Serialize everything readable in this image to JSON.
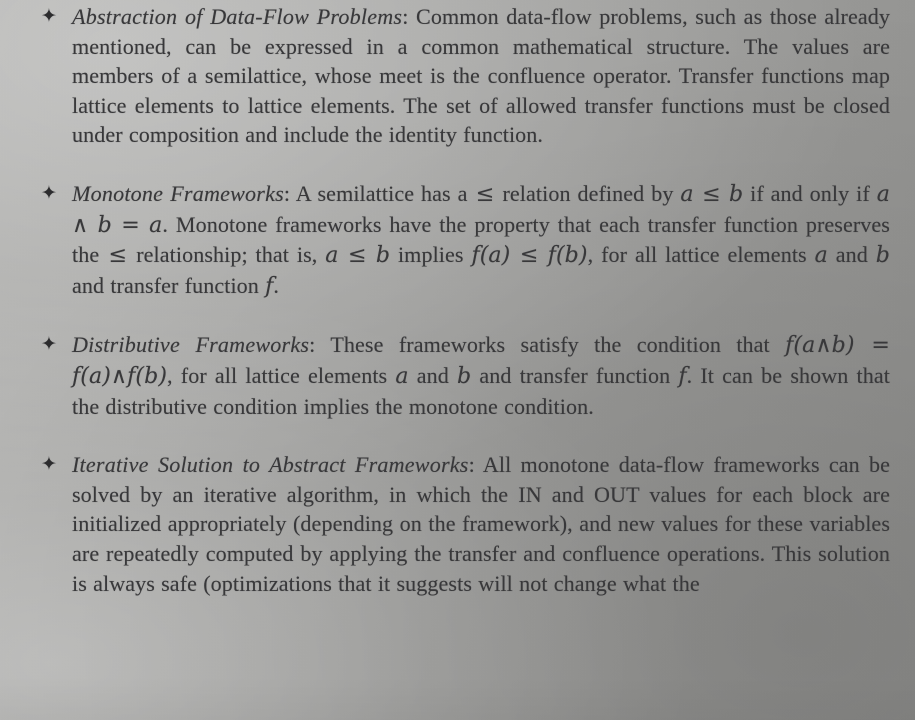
{
  "page": {
    "type": "scanned-textbook-page",
    "background_color": "#a3a3a1",
    "text_color": "#38383a",
    "bullet_glyph": "✦",
    "bullet_glyph_name": "four-pointed-star-bullet"
  },
  "bullets": [
    {
      "marker": "✦",
      "term": "Abstraction of Data-Flow Problems",
      "separator": ": ",
      "body": "Common data-flow problems, such as those already mentioned, can be expressed in a common mathematical structure. The values are members of a semilattice, whose meet is the confluence operator. Transfer functions map lattice elements to lattice elements. The set of allowed transfer functions must be closed under composition and include the identity function."
    },
    {
      "marker": "✦",
      "term": "Monotone Frameworks",
      "separator": ": ",
      "body_part1": "A semilattice has a ",
      "math1": "≤",
      "body_part2": " relation defined by ",
      "math2": "a ≤ b",
      "body_part3": " if and only if ",
      "math3": "a ∧ b = a",
      "body_part4": ". Monotone frameworks have the property that each transfer function preserves the ",
      "math4": "≤",
      "body_part5": " relationship; that is, ",
      "math5": "a ≤ b",
      "body_part6": " implies ",
      "math6": "f(a) ≤ f(b)",
      "body_part7": ", for all lattice elements ",
      "math7": "a",
      "body_part8": " and ",
      "math8": "b",
      "body_part9": " and transfer function ",
      "math9": "f",
      "body_part10": "."
    },
    {
      "marker": "✦",
      "term": "Distributive Frameworks",
      "separator": ": ",
      "body_part1": "These frameworks satisfy the condition that ",
      "math1": "f(a∧b) = f(a)∧f(b)",
      "body_part2": ", for all lattice elements ",
      "math2": "a",
      "body_part3": " and ",
      "math3": "b",
      "body_part4": " and transfer function ",
      "math4": "f",
      "body_part5": ". It can be shown that the distributive condition implies the monotone condition."
    },
    {
      "marker": "✦",
      "term": "Iterative Solution to Abstract Frameworks",
      "separator": ": ",
      "body": "All monotone data-flow frameworks can be solved by an iterative algorithm, in which the IN and OUT values for each block are initialized appropriately (depending on the framework), and new values for these variables are repeatedly computed by applying the transfer and confluence operations. This solution is always safe (optimizations that it suggests will not change what the"
    }
  ]
}
